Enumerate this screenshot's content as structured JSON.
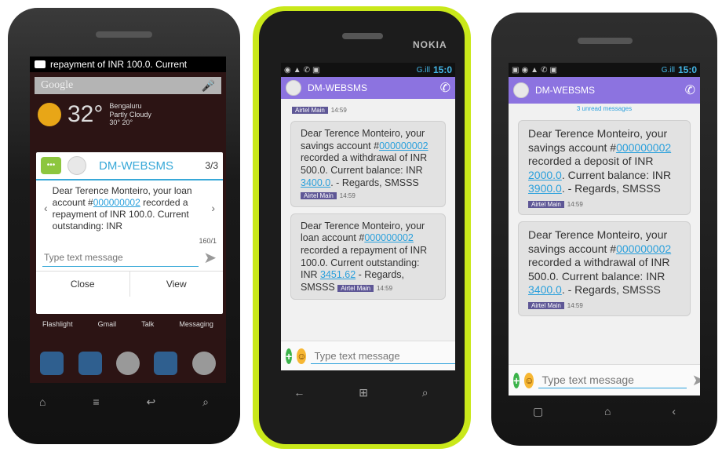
{
  "phone1": {
    "notification": "repayment of INR 100.0. Current",
    "search_placeholder": "Google",
    "weather": {
      "temp": "32°",
      "city": "Bengaluru",
      "condition": "Partly Cloudy",
      "range": "30° 20°"
    },
    "popup": {
      "sender": "DM-WEBSMS",
      "count": "3/3",
      "message_prefix": "Dear Terence Monteiro, your loan account #",
      "account": "000000002",
      "message_suffix": "recorded a repayment of INR 100.0. Current outstanding: INR",
      "char_counter": "160/1",
      "input_placeholder": "Type text message",
      "close_label": "Close",
      "view_label": "View"
    },
    "dock_labels": [
      "Flashlight",
      "Gmail",
      "Talk",
      "Messaging"
    ]
  },
  "phone2": {
    "brand": "NOKIA",
    "status_time": "15:0",
    "status_signal": "G.ill",
    "sender": "DM-WEBSMS",
    "messages": [
      {
        "pre": "Dear Terence Monteiro, your savings account #",
        "account": "000000002",
        "mid": " recorded a withdrawal of INR 500.0. Current balance: INR ",
        "amount": "3400.0",
        "post": ". - Regards, SMSSS",
        "carrier": "Airtel Main",
        "time": "14:59"
      },
      {
        "pre": "Dear Terence Monteiro, your loan account #",
        "account": "000000002",
        "mid": " recorded a repayment of INR 100.0. Current outstanding: INR ",
        "amount": "3451.62",
        "post": " - Regards, SMSSS",
        "carrier": "Airtel Main",
        "time": "14:59"
      }
    ],
    "top_carrier": "Airtel Main",
    "top_time": "14:59",
    "input_placeholder": "Type text message"
  },
  "phone3": {
    "status_time": "15:0",
    "status_signal": "G.ill",
    "sender": "DM-WEBSMS",
    "unread": "3 unread messages",
    "messages": [
      {
        "pre": "Dear Terence Monteiro, your savings account #",
        "account": "000000002",
        "mid": " recorded a deposit of INR ",
        "amount1": "2000.0",
        "mid2": ". Current balance: INR ",
        "amount": "3900.0",
        "post": ". - Regards, SMSSS",
        "carrier": "Airtel Main",
        "time": "14:59"
      },
      {
        "pre": "Dear Terence Monteiro, your savings account #",
        "account": "000000002",
        "mid": " recorded a withdrawal of INR 500.0. Current balance: INR ",
        "amount": "3400.0",
        "post": ". - Regards, SMSSS",
        "carrier": "Airtel Main",
        "time": "14:59"
      }
    ],
    "input_placeholder": "Type text message"
  }
}
